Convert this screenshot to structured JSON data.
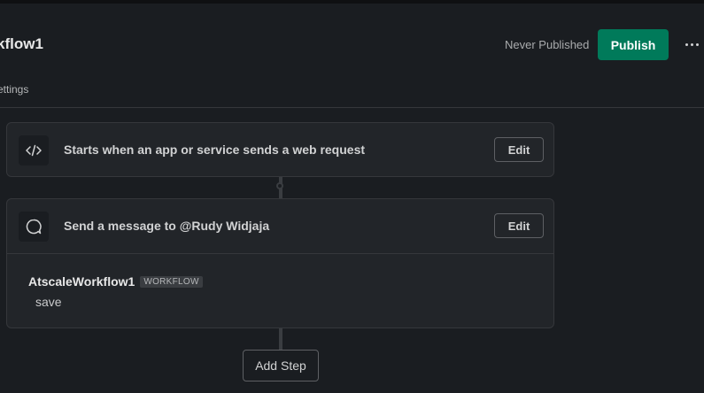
{
  "header": {
    "title": "kflow1",
    "status": "Never Published",
    "publish_label": "Publish"
  },
  "tabs": {
    "settings_label": "ettings"
  },
  "steps": [
    {
      "icon": "code-icon",
      "label": "Starts when an app or service sends a web request",
      "edit_label": "Edit"
    },
    {
      "icon": "message-bubble-icon",
      "label": "Send a message to @Rudy Widjaja",
      "edit_label": "Edit",
      "preview": {
        "sender": "AtscaleWorkflow1",
        "badge": "WORKFLOW",
        "message": "save"
      }
    }
  ],
  "add_step_label": "Add Step",
  "colors": {
    "background": "#1a1d21",
    "card": "#222529",
    "publish": "#007a5a"
  }
}
